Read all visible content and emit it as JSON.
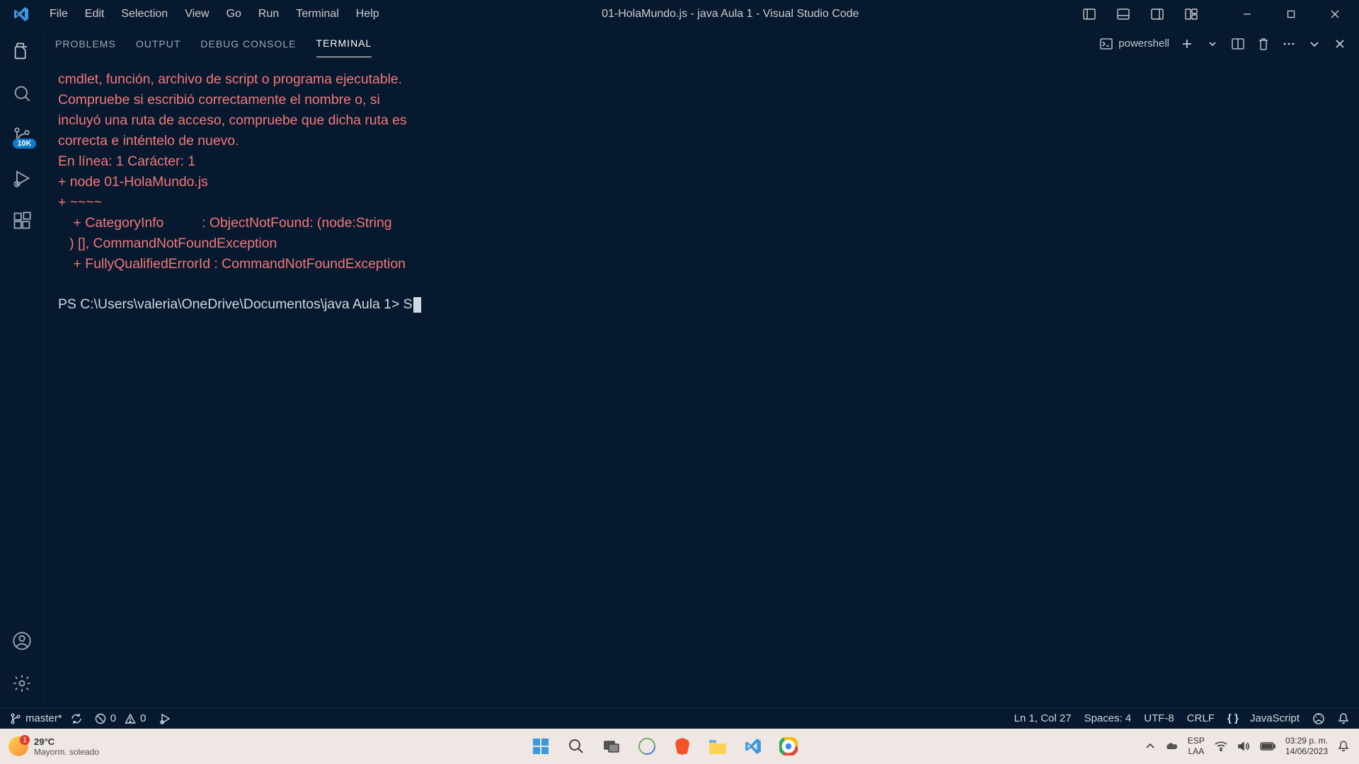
{
  "window": {
    "title": "01-HolaMundo.js - java Aula 1 - Visual Studio Code"
  },
  "menu": [
    "File",
    "Edit",
    "Selection",
    "View",
    "Go",
    "Run",
    "Terminal",
    "Help"
  ],
  "activity": {
    "scm_badge": "10K"
  },
  "panel": {
    "tabs": [
      "PROBLEMS",
      "OUTPUT",
      "DEBUG CONSOLE",
      "TERMINAL"
    ],
    "active": "TERMINAL",
    "shell": "powershell"
  },
  "terminal": {
    "error_lines": [
      "cmdlet, función, archivo de script o programa ejecutable.",
      "Compruebe si escribió correctamente el nombre o, si",
      "incluyó una ruta de acceso, compruebe que dicha ruta es",
      "correcta e inténtelo de nuevo.",
      "En línea: 1 Carácter: 1",
      "+ node 01-HolaMundo.js",
      "+ ~~~~",
      "    + CategoryInfo          : ObjectNotFound: (node:String",
      "   ) [], CommandNotFoundException",
      "    + FullyQualifiedErrorId : CommandNotFoundException"
    ],
    "prompt": "PS C:\\Users\\valeria\\OneDrive\\Documentos\\java Aula 1> S"
  },
  "status": {
    "branch": "master*",
    "errors": "0",
    "warnings": "0",
    "pos": "Ln 1, Col 27",
    "spaces": "Spaces: 4",
    "encoding": "UTF-8",
    "eol": "CRLF",
    "lang": "JavaScript"
  },
  "taskbar": {
    "temp": "29°C",
    "weather": "Mayorm. soleado",
    "lang1": "ESP",
    "lang2": "LAA",
    "time": "03:29 p. m.",
    "date": "14/06/2023"
  }
}
